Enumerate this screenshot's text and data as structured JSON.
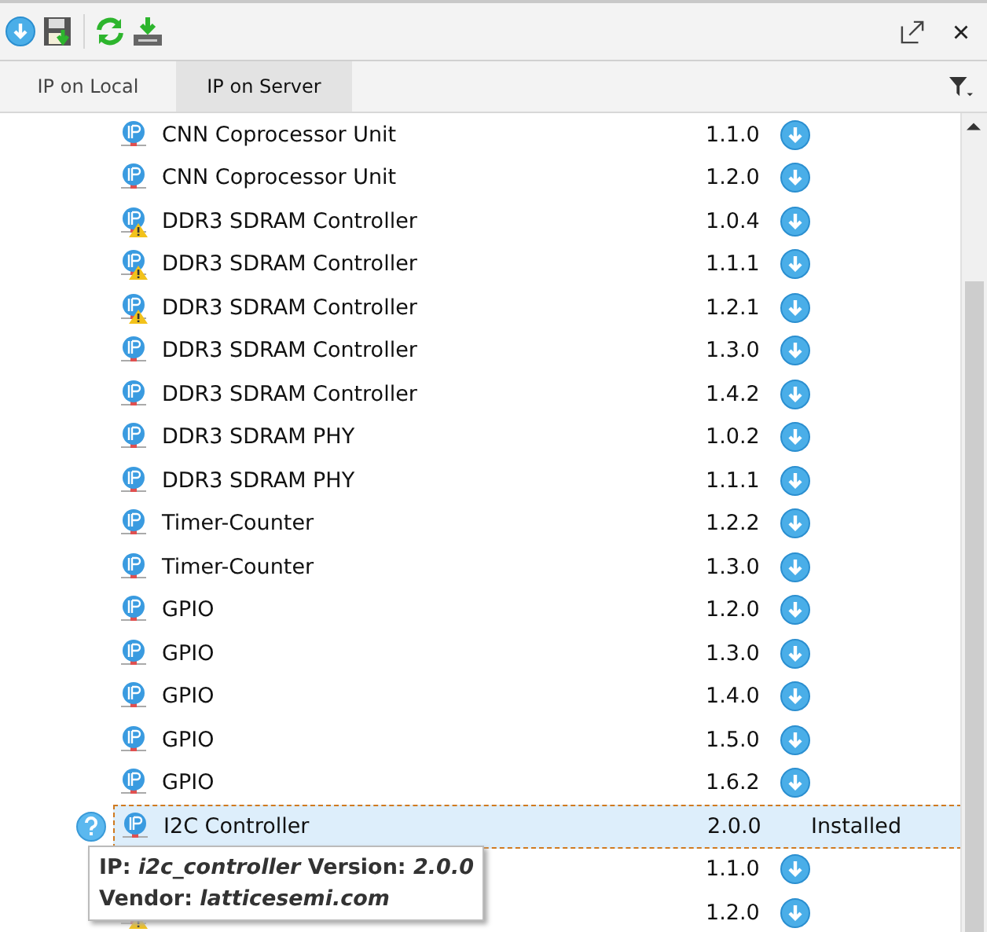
{
  "tabs": [
    {
      "label": "IP on Local",
      "selected": false
    },
    {
      "label": "IP on Server",
      "selected": true
    }
  ],
  "rows": [
    {
      "name": "CNN Coprocessor Unit",
      "version": "1.1.0",
      "warning": false,
      "selected": false
    },
    {
      "name": "CNN Coprocessor Unit",
      "version": "1.2.0",
      "warning": false,
      "selected": false
    },
    {
      "name": "DDR3 SDRAM Controller",
      "version": "1.0.4",
      "warning": true,
      "selected": false
    },
    {
      "name": "DDR3 SDRAM Controller",
      "version": "1.1.1",
      "warning": true,
      "selected": false
    },
    {
      "name": "DDR3 SDRAM Controller",
      "version": "1.2.1",
      "warning": true,
      "selected": false
    },
    {
      "name": "DDR3 SDRAM Controller",
      "version": "1.3.0",
      "warning": false,
      "selected": false
    },
    {
      "name": "DDR3 SDRAM Controller",
      "version": "1.4.2",
      "warning": false,
      "selected": false
    },
    {
      "name": "DDR3 SDRAM PHY",
      "version": "1.0.2",
      "warning": false,
      "selected": false
    },
    {
      "name": "DDR3 SDRAM PHY",
      "version": "1.1.1",
      "warning": false,
      "selected": false
    },
    {
      "name": "Timer-Counter",
      "version": "1.2.2",
      "warning": false,
      "selected": false
    },
    {
      "name": "Timer-Counter",
      "version": "1.3.0",
      "warning": false,
      "selected": false
    },
    {
      "name": "GPIO",
      "version": "1.2.0",
      "warning": false,
      "selected": false
    },
    {
      "name": "GPIO",
      "version": "1.3.0",
      "warning": false,
      "selected": false
    },
    {
      "name": "GPIO",
      "version": "1.4.0",
      "warning": false,
      "selected": false
    },
    {
      "name": "GPIO",
      "version": "1.5.0",
      "warning": false,
      "selected": false
    },
    {
      "name": "GPIO",
      "version": "1.6.2",
      "warning": false,
      "selected": false
    },
    {
      "name": "I2C Controller",
      "version": "2.0.0",
      "warning": false,
      "selected": true,
      "status": "Installed"
    },
    {
      "version": "1.1.0",
      "selected": false
    },
    {
      "version": "1.2.0",
      "warning": true,
      "selected": false
    }
  ],
  "tooltip": {
    "lines": [
      "IP: *i2c_controller* Version: *2.0.0*",
      "Vendor: *latticesemi.com*"
    ]
  }
}
